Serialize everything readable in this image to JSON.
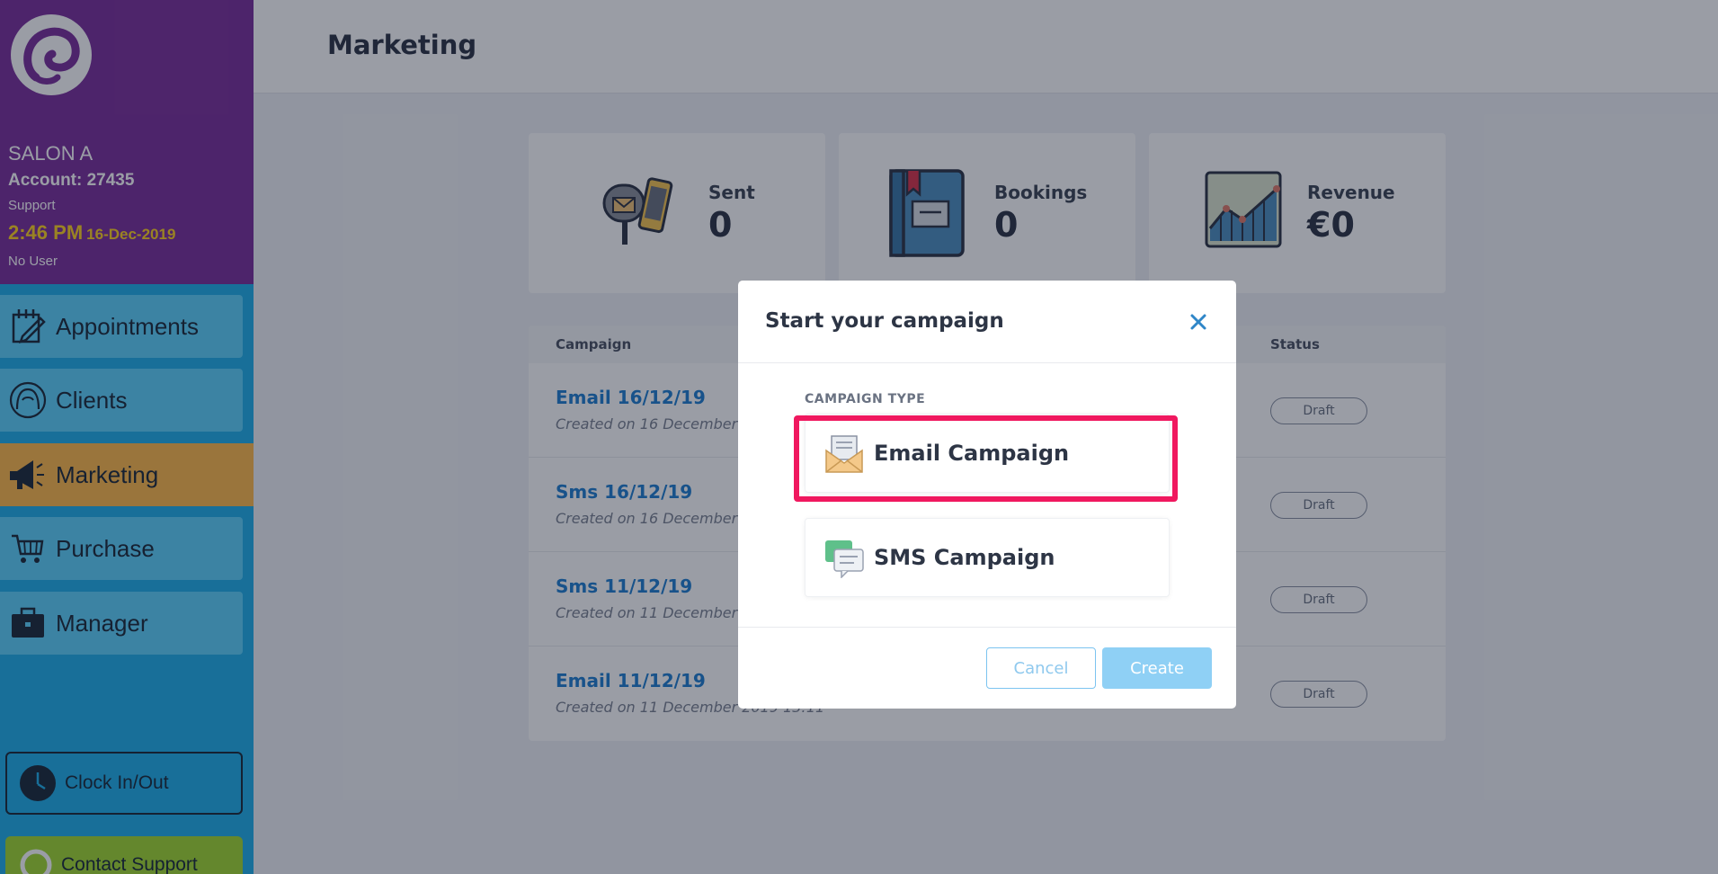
{
  "sidebar": {
    "salon_name": "SALON A",
    "account": "Account: 27435",
    "role": "Support",
    "time": "2:46 PM",
    "date": "16-Dec-2019",
    "user": "No User",
    "nav": [
      {
        "label": "Appointments",
        "icon": "calendar-edit-icon"
      },
      {
        "label": "Clients",
        "icon": "client-head-icon"
      },
      {
        "label": "Marketing",
        "icon": "megaphone-icon"
      },
      {
        "label": "Purchase",
        "icon": "cart-icon"
      },
      {
        "label": "Manager",
        "icon": "briefcase-icon"
      }
    ],
    "active_nav": "Marketing",
    "clock_label": "Clock In/Out",
    "support_label": "Contact Support"
  },
  "header": {
    "title": "Marketing"
  },
  "stats": [
    {
      "label": "Sent",
      "value": "0",
      "icon": "mailbox-phone-icon"
    },
    {
      "label": "Bookings",
      "value": "0",
      "icon": "book-icon"
    },
    {
      "label": "Revenue",
      "value": "€0",
      "icon": "line-chart-icon"
    }
  ],
  "table": {
    "headers": {
      "campaign": "Campaign",
      "status": "Status"
    },
    "rows": [
      {
        "name": "Email 16/12/19",
        "created": "Created on 16 December",
        "status": "Draft"
      },
      {
        "name": "Sms 16/12/19",
        "created": "Created on 16 December",
        "status": "Draft"
      },
      {
        "name": "Sms 11/12/19",
        "created": "Created on 11 December",
        "status": "Draft"
      },
      {
        "name": "Email 11/12/19",
        "created": "Created on 11 December 2019 13:11",
        "status": "Draft"
      }
    ]
  },
  "modal": {
    "title": "Start your campaign",
    "section_label": "CAMPAIGN TYPE",
    "options": [
      {
        "label": "Email Campaign",
        "icon": "envelope-icon",
        "selected": true
      },
      {
        "label": "SMS Campaign",
        "icon": "chat-bubbles-icon",
        "selected": false
      }
    ],
    "cancel_label": "Cancel",
    "create_label": "Create"
  },
  "colors": {
    "sidebar_top": "#7b2f9c",
    "sidebar": "#1fb0ea",
    "nav_item": "#5ed3fb",
    "nav_active": "#ffba4a",
    "highlight": "#f0185f",
    "link": "#1f7fd0"
  }
}
